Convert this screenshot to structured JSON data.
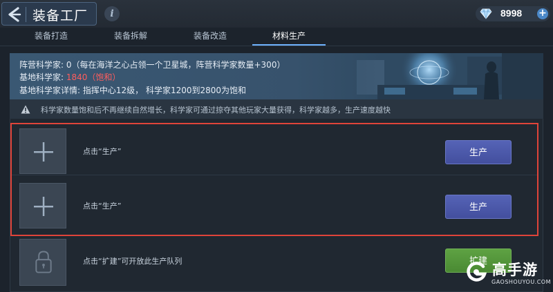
{
  "header": {
    "title": "装备工厂",
    "info_glyph": "i",
    "back_icon": "back-arrow-icon",
    "currency": {
      "icon": "diamond-icon",
      "value": "8998",
      "plus": "+"
    }
  },
  "tabs": [
    {
      "label": "装备打造",
      "active": false
    },
    {
      "label": "装备拆解",
      "active": false
    },
    {
      "label": "装备改造",
      "active": false
    },
    {
      "label": "材料生产",
      "active": true
    }
  ],
  "banner": {
    "faction_label": "阵营科学家: 0（每在海洋之心占领一个卫星城，阵营科学家数量+300）",
    "base_label": "基地科学家: ",
    "base_value": "1840（饱和）",
    "detail_label": "基地科学家详情: 指挥中心12级， 科学家1200到2800为饱和"
  },
  "notice": {
    "icon": "warning-icon",
    "text": "科学家数量饱和后不再继续自然增长，科学家可通过掠夺其他玩家大量获得，科学家越多，生产速度越快"
  },
  "slots": [
    {
      "icon": "plus-icon",
      "text": "点击“生产”",
      "button": "生产",
      "button_style": "blue",
      "highlighted": true
    },
    {
      "icon": "plus-icon",
      "text": "点击“生产”",
      "button": "生产",
      "button_style": "blue",
      "highlighted": true
    },
    {
      "icon": "lock-icon",
      "text": "点击“扩建”可开放此生产队列",
      "button": "扩建",
      "button_style": "green",
      "highlighted": false
    }
  ],
  "watermark": {
    "name": "高手游",
    "url": "GAOSHOUYOU.COM"
  },
  "colors": {
    "highlight_border": "#e0443a",
    "warning_value": "#ff5d5d",
    "button_blue": "#4b57a8",
    "button_green": "#559a3d",
    "active_tab_underline": "#6fb3ff"
  }
}
